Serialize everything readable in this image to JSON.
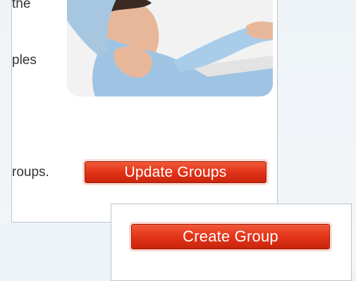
{
  "main_panel": {
    "text_line_1": "the",
    "text_line_2": "ples",
    "text_line_3": "roups.",
    "update_button_label": "Update Groups"
  },
  "photo": {
    "subject": "man-receiving-shoulder-massage-image",
    "skin_color": "#e8b79a",
    "shirt_color": "#9fc4e3",
    "hair_color": "#3a2a22"
  },
  "second_panel": {
    "create_button_label": "Create Group"
  },
  "colors": {
    "button_red": "#e4351a",
    "panel_border": "#bcc5cd",
    "background": "#eef3f7"
  }
}
